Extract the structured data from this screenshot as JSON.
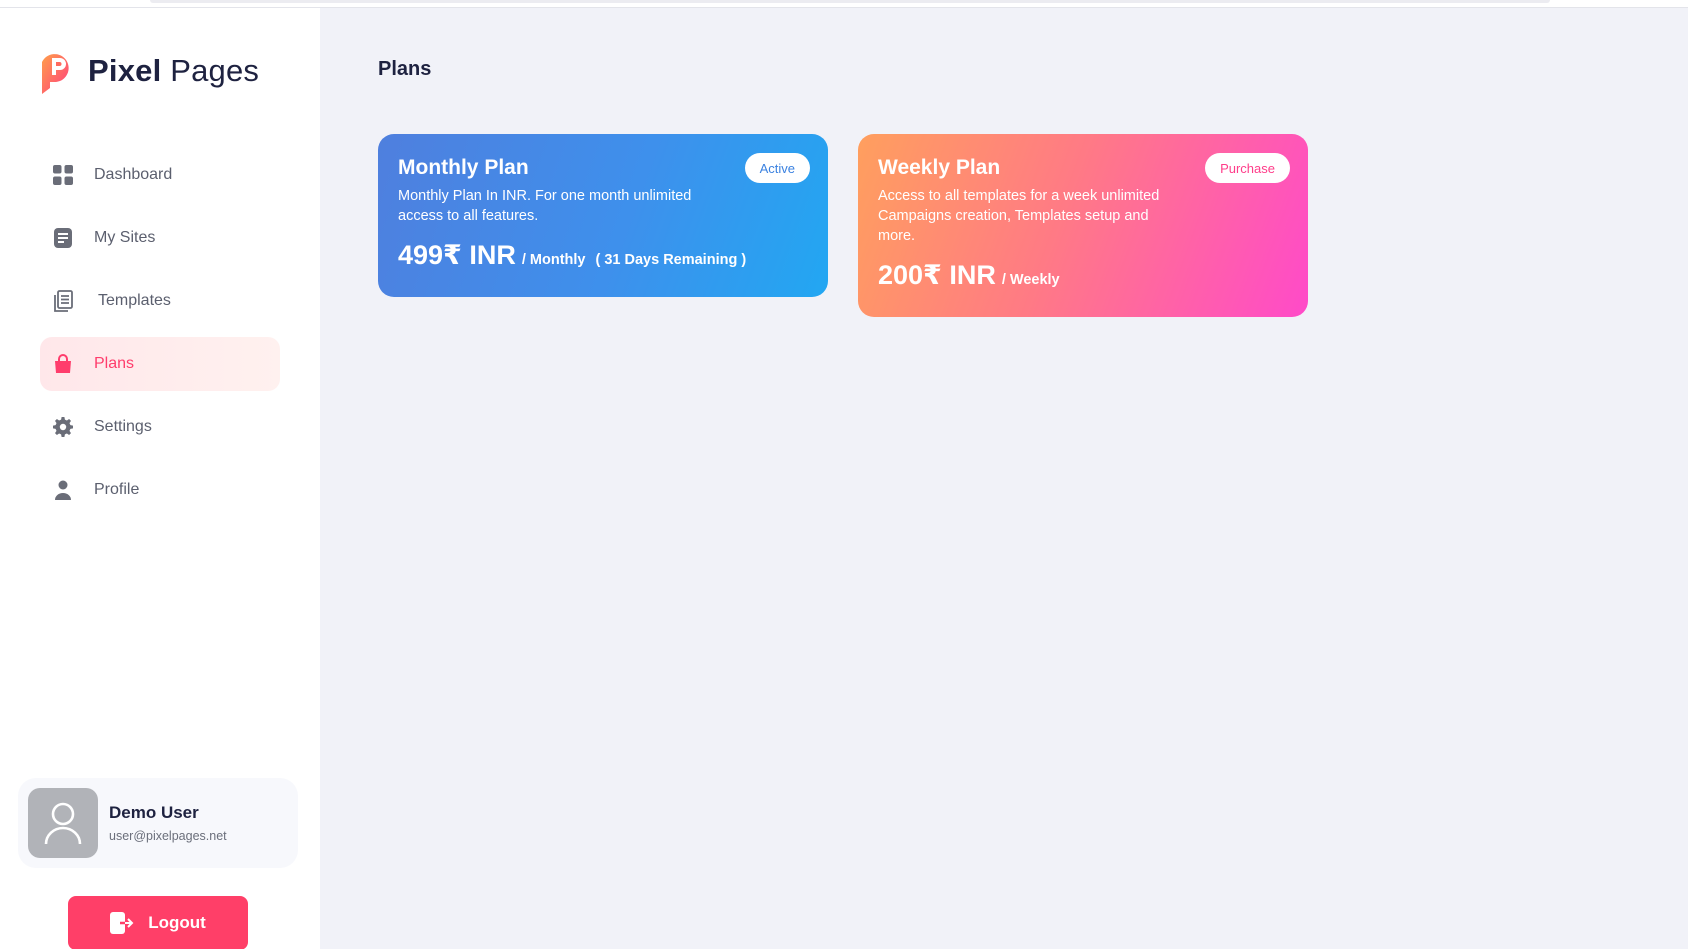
{
  "app": {
    "brand_bold": "Pixel",
    "brand_light": "Pages"
  },
  "sidebar": {
    "items": [
      {
        "label": "Dashboard",
        "icon": "grid-icon",
        "active": false
      },
      {
        "label": "My Sites",
        "icon": "document-icon",
        "active": false
      },
      {
        "label": "Templates",
        "icon": "pages-icon",
        "active": false
      },
      {
        "label": "Plans",
        "icon": "shopping-bag-icon",
        "active": true
      },
      {
        "label": "Settings",
        "icon": "gear-icon",
        "active": false
      },
      {
        "label": "Profile",
        "icon": "user-icon",
        "active": false
      }
    ]
  },
  "user": {
    "name": "Demo User",
    "email": "user@pixelpages.net"
  },
  "logout": {
    "label": "Logout"
  },
  "page": {
    "title": "Plans"
  },
  "plans": [
    {
      "name": "Monthly Plan",
      "description": "Monthly Plan In INR. For one month unlimited access to all features.",
      "price": "499₹ INR",
      "period": "/ Monthly",
      "remaining": "( 31 Days Remaining )",
      "badge": "Active"
    },
    {
      "name": "Weekly Plan",
      "description": "Access to all templates for a week unlimited Campaigns creation, Templates setup and more.",
      "price": "200₹ INR",
      "period": "/ Weekly",
      "badge": "Purchase"
    }
  ],
  "colors": {
    "accent": "#ff3f68",
    "background": "#f1f2f8",
    "monthly_gradient_start": "#4f7fde",
    "monthly_gradient_end": "#22a7f2",
    "weekly_gradient_start": "#ff9f5e",
    "weekly_gradient_end": "#ff4ac9"
  }
}
